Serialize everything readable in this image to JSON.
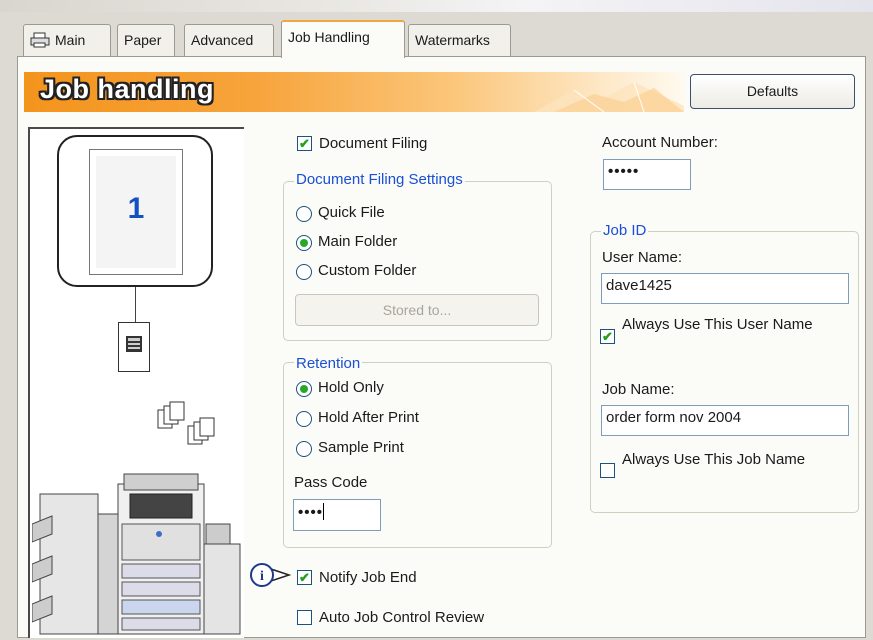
{
  "tabs": [
    {
      "label": "Main",
      "active": false
    },
    {
      "label": "Paper",
      "active": false
    },
    {
      "label": "Advanced",
      "active": false
    },
    {
      "label": "Job Handling",
      "active": true
    },
    {
      "label": "Watermarks",
      "active": false
    }
  ],
  "header": {
    "title": "Job handling",
    "defaults_label": "Defaults"
  },
  "preview": {
    "page_number": "1"
  },
  "document_filing": {
    "checkbox_label": "Document Filing",
    "checked": true,
    "settings_title": "Document Filing Settings",
    "options": [
      {
        "label": "Quick File",
        "selected": false
      },
      {
        "label": "Main Folder",
        "selected": true
      },
      {
        "label": "Custom Folder",
        "selected": false
      }
    ],
    "stored_to_label": "Stored to..."
  },
  "retention": {
    "title": "Retention",
    "options": [
      {
        "label": "Hold Only",
        "selected": true
      },
      {
        "label": "Hold After Print",
        "selected": false
      },
      {
        "label": "Sample Print",
        "selected": false
      }
    ],
    "pass_code_label": "Pass Code",
    "pass_code_value": "••••"
  },
  "notify_job_end": {
    "label": "Notify Job End",
    "checked": true
  },
  "auto_job_control_review": {
    "label": "Auto Job Control Review",
    "checked": false
  },
  "account": {
    "label": "Account Number:",
    "value": "•••••"
  },
  "job_id": {
    "title": "Job ID",
    "user_name_label": "User Name:",
    "user_name_value": "dave1425",
    "always_use_user_name_label": "Always Use This User Name",
    "always_use_user_name_checked": true,
    "job_name_label": "Job Name:",
    "job_name_value": "order form nov 2004",
    "always_use_job_name_label": "Always Use This Job Name",
    "always_use_job_name_checked": false
  },
  "colors": {
    "banner_orange": "#f3941c",
    "group_title_blue": "#1a4fd6",
    "check_green": "#21a121"
  }
}
